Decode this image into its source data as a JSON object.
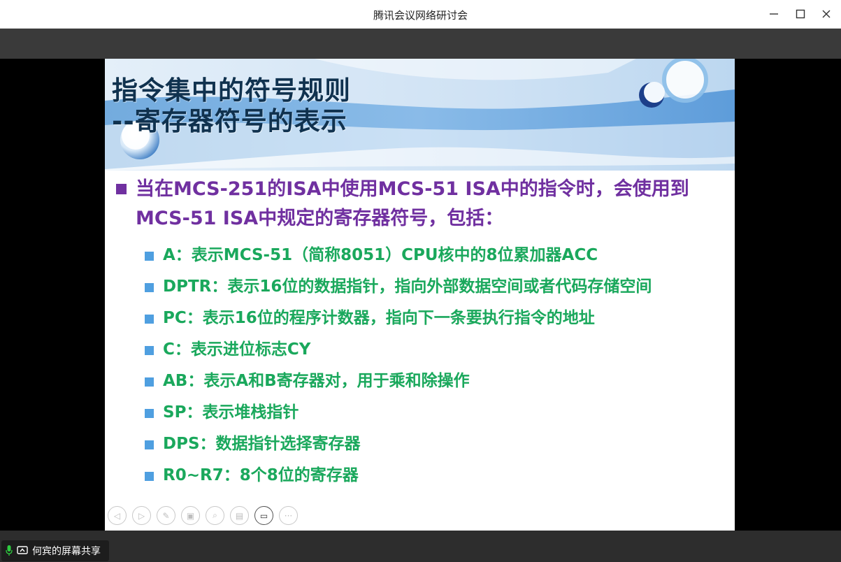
{
  "window": {
    "title": "腾讯会议网络研讨会"
  },
  "slide": {
    "title_lines": [
      "指令集中的符号规则",
      "--寄存器符号的表示"
    ],
    "main_bullet": "当在MCS-251的ISA中使用MCS-51 ISA中的指令时，会使用到MCS-51 ISA中规定的寄存器符号，包括：",
    "sub_bullets": [
      "A：表示MCS-51（简称8051）CPU核中的8位累加器ACC",
      "DPTR：表示16位的数据指针，指向外部数据空间或者代码存储空间",
      "PC：表示16位的程序计数器，指向下一条要执行指令的地址",
      "C：表示进位标志CY",
      "AB：表示A和B寄存器对，用于乘和除操作",
      "SP：表示堆栈指针",
      "DPS：数据指针选择寄存器",
      "R0~R7：8个8位的寄存器"
    ],
    "colors": {
      "title": "#10324f",
      "main_bullet": "#7030a0",
      "sub_bullet_text": "#1aa85c",
      "sub_bullet_marker": "#4f9fe0"
    }
  },
  "slide_controls": [
    {
      "icon": "previous-icon",
      "glyph": "◁"
    },
    {
      "icon": "next-icon",
      "glyph": "▷"
    },
    {
      "icon": "pen-icon",
      "glyph": "✎"
    },
    {
      "icon": "slides-icon",
      "glyph": "▣"
    },
    {
      "icon": "zoom-icon",
      "glyph": "⌕"
    },
    {
      "icon": "subtitle-icon",
      "glyph": "▤"
    },
    {
      "icon": "video-icon",
      "glyph": "▭"
    },
    {
      "icon": "more-icon",
      "glyph": "···"
    }
  ],
  "bottom": {
    "share_label": "何宾的屏幕共享"
  }
}
